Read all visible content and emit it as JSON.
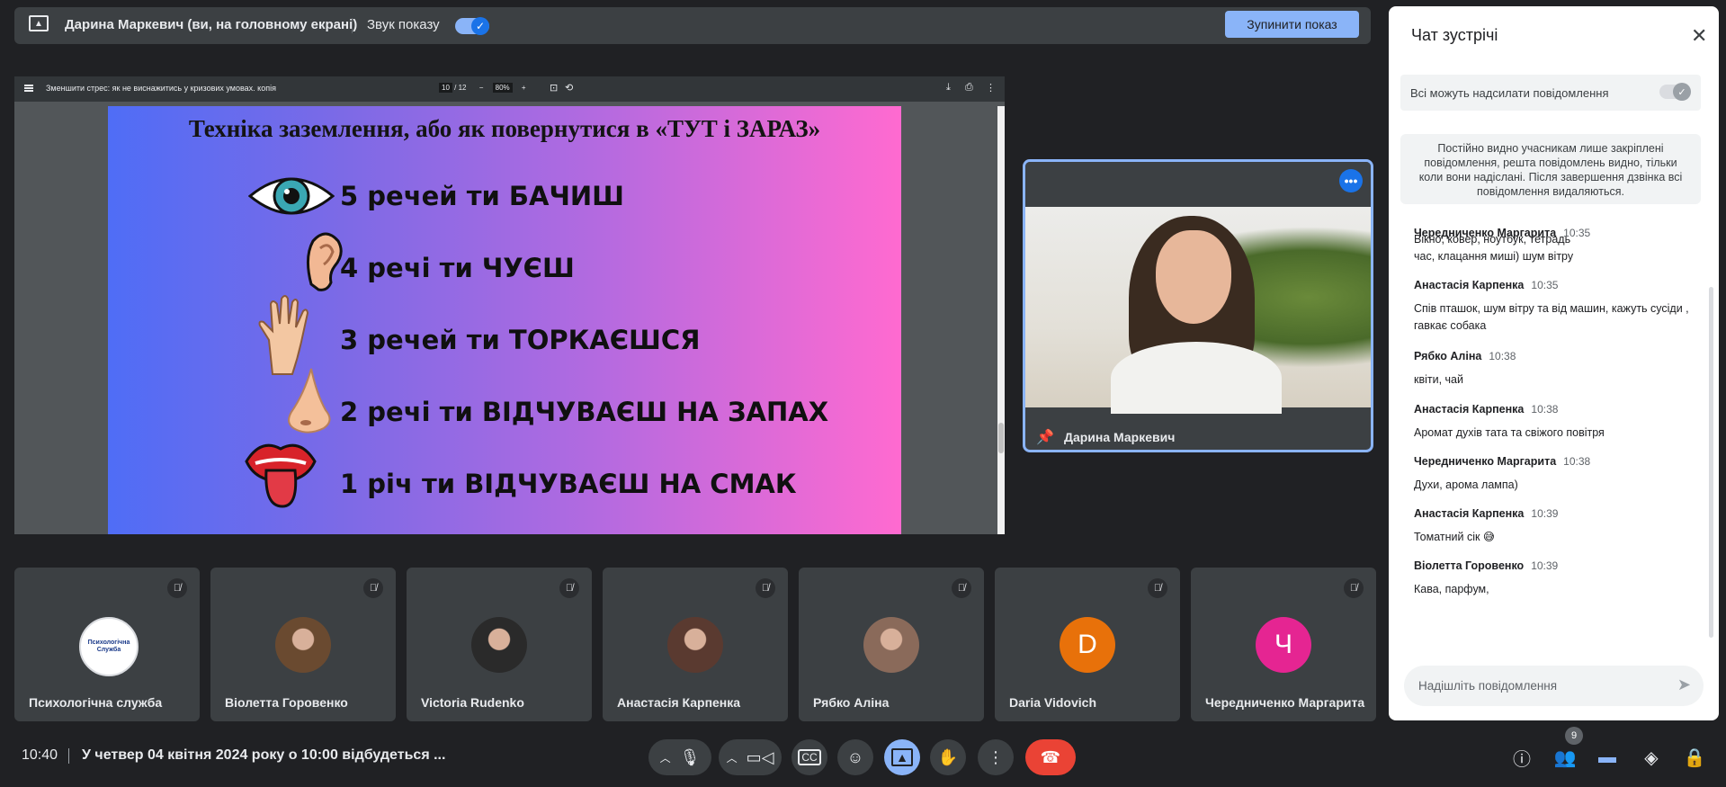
{
  "presenting_bar": {
    "presenter_text": "Дарина Маркевич (ви, на головному екрані)",
    "sound_label": "Звук показу",
    "stop_button": "Зупинити показ"
  },
  "document": {
    "title": "Зменшити стрес: як не виснажитись у кризових умовах. копія",
    "page_current": "10",
    "page_total": "/ 12",
    "zoom": "80%"
  },
  "slide": {
    "title": "Техніка заземлення, або як повернутися в «ТУТ і ЗАРАЗ»",
    "senses": [
      "5 речей ти БАЧИШ",
      "4 речі ти ЧУЄШ",
      "3 речей ти ТОРКАЄШСЯ",
      "2 речі ти ВІДЧУВАЄШ НА ЗАПАХ",
      "1 річ ти ВІДЧУВАЄШ НА СМАК"
    ]
  },
  "pinned": {
    "name": "Дарина Маркевич"
  },
  "participants": [
    {
      "name": "Психологічна служба",
      "avatar_type": "logo",
      "avatar_text": "Психологічна Служба"
    },
    {
      "name": "Віолетта Горовенко",
      "avatar_type": "photo",
      "avatar_color": "#6a4a30"
    },
    {
      "name": "Victoria Rudenko",
      "avatar_type": "photo",
      "avatar_color": "#2a2a2a"
    },
    {
      "name": "Анастасія Карпенка",
      "avatar_type": "photo",
      "avatar_color": "#5a3a30"
    },
    {
      "name": "Рябко Аліна",
      "avatar_type": "photo",
      "avatar_color": "#8a6a5a"
    },
    {
      "name": "Daria Vidovich",
      "avatar_type": "letter",
      "letter": "D",
      "avatar_color": "#e8710a"
    },
    {
      "name": "Чередниченко Маргарита",
      "avatar_type": "letter",
      "letter": "Ч",
      "avatar_color": "#e52592"
    }
  ],
  "bottom_bar": {
    "time": "10:40",
    "meeting_info": "У четвер 04 квітня 2024 року о 10:00 відбудеться ...",
    "people_count": "9"
  },
  "chat": {
    "title": "Чат зустрічі",
    "allow_label": "Всі можуть надсилати повідомлення",
    "notice": "Постійно видно учасникам лише закріплені повідомлення, решта повідомлень видно, тільки коли вони надіслані. Після завершення дзвінка всі повідомлення видаляються.",
    "partial_first": "Вікно, ковер, ноутбук, тетрадь",
    "messages": [
      {
        "sender": "Чередниченко Маргарита",
        "time": "10:35",
        "text": "час, клацання миші) шум вітру"
      },
      {
        "sender": "Анастасія Карпенка",
        "time": "10:35",
        "text": "Спів пташок, шум вітру та від машин, кажуть сусіди , гавкає собака"
      },
      {
        "sender": "Рябко Аліна",
        "time": "10:38",
        "text": "квіти, чай"
      },
      {
        "sender": "Анастасія Карпенка",
        "time": "10:38",
        "text": "Аромат духів тата та свіжого повітря"
      },
      {
        "sender": "Чередниченко Маргарита",
        "time": "10:38",
        "text": "Духи, арома лампа)"
      },
      {
        "sender": "Анастасія Карпенка",
        "time": "10:39",
        "text": "Томатний сік 😅"
      },
      {
        "sender": "Віолетта Горовенко",
        "time": "10:39",
        "text": "Кава, парфум,"
      }
    ],
    "input_placeholder": "Надішліть повідомлення"
  }
}
